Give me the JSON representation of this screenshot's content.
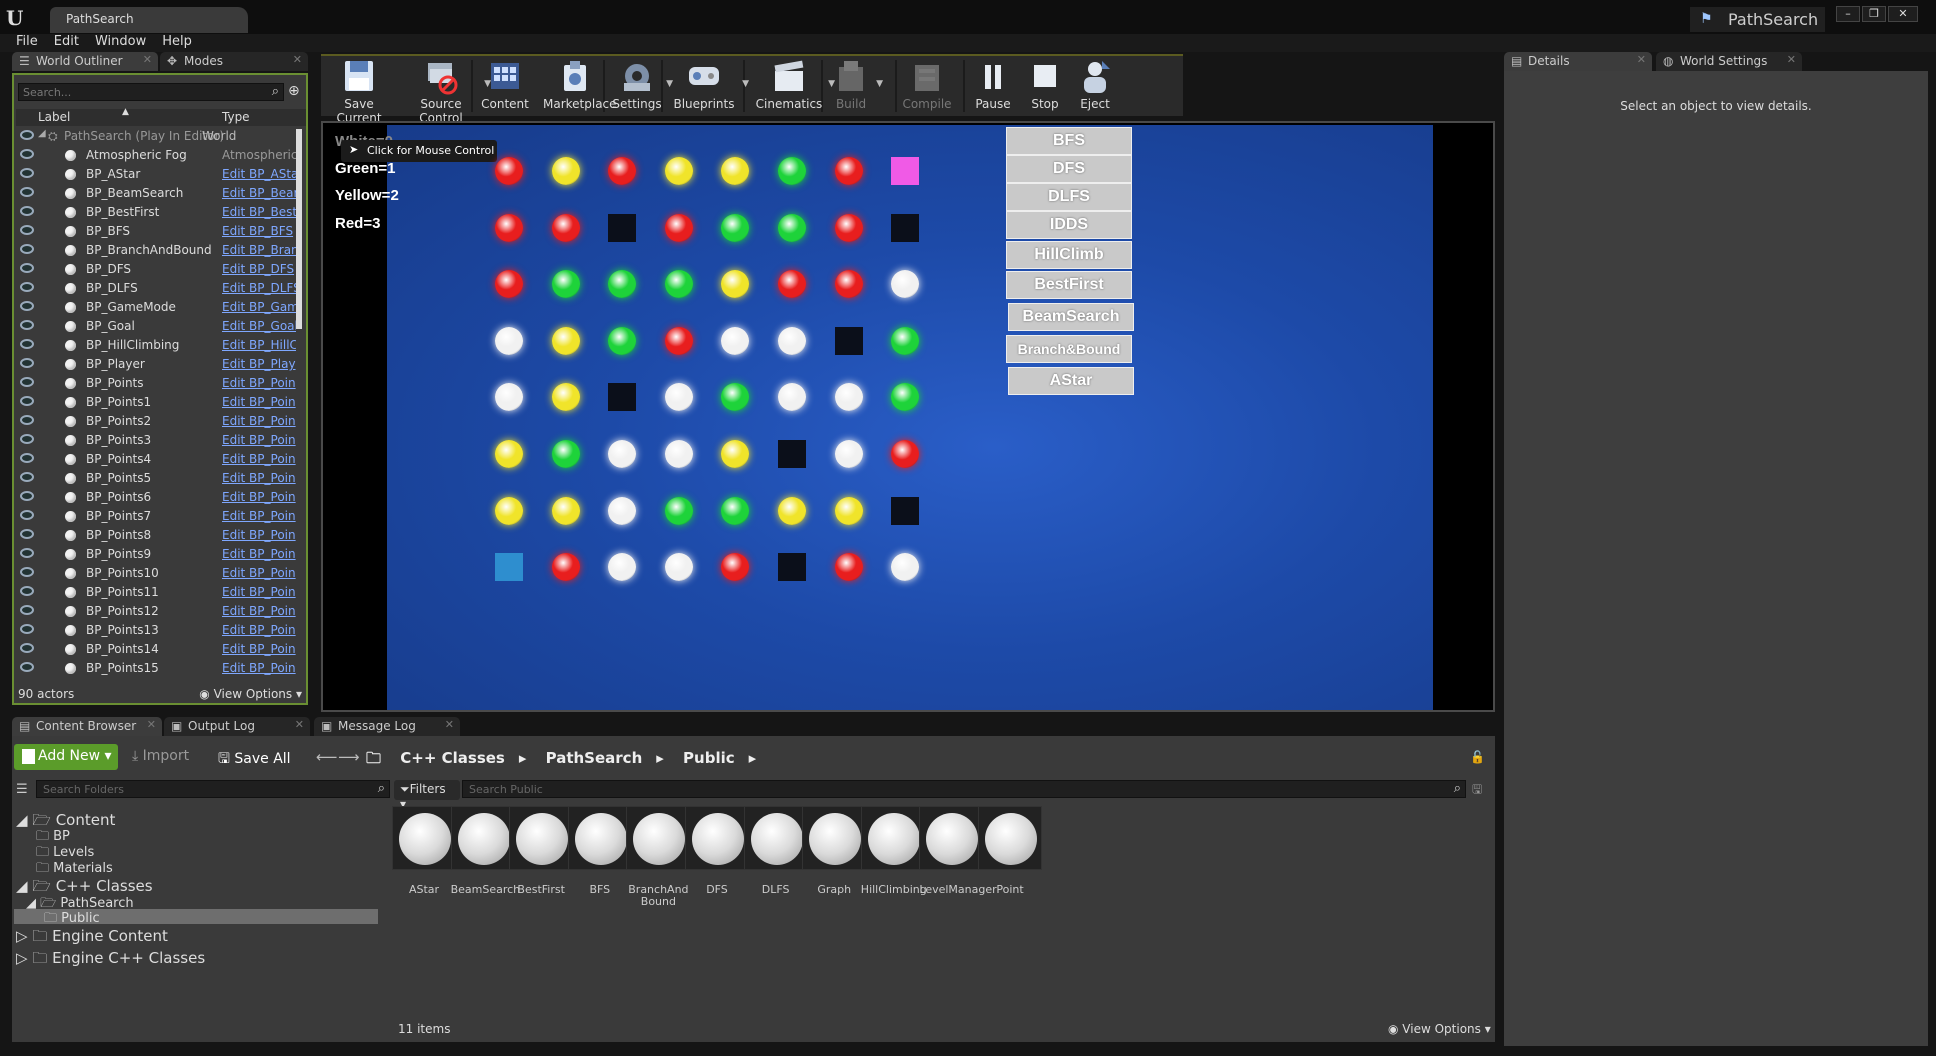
{
  "window": {
    "doc_tab": "PathSearch",
    "project_name": "PathSearch",
    "min": "–",
    "restore": "❐",
    "close": "✕"
  },
  "menu": [
    "File",
    "Edit",
    "Window",
    "Help"
  ],
  "outliner": {
    "tab_label": "World Outliner",
    "modes_tab_label": "Modes",
    "search_placeholder": "Search...",
    "col_label": "Label",
    "col_type": "Type",
    "root_label": "PathSearch (Play In Editor)",
    "root_type": "World",
    "rows": [
      {
        "label": "Atmospheric Fog",
        "type": "AtmosphericF"
      },
      {
        "label": "BP_AStar",
        "type": "Edit BP_AStar"
      },
      {
        "label": "BP_BeamSearch",
        "type": "Edit BP_Bear"
      },
      {
        "label": "BP_BestFirst",
        "type": "Edit BP_Best"
      },
      {
        "label": "BP_BFS",
        "type": "Edit BP_BFS"
      },
      {
        "label": "BP_BranchAndBound",
        "type": "Edit BP_Bran"
      },
      {
        "label": "BP_DFS",
        "type": "Edit BP_DFS"
      },
      {
        "label": "BP_DLFS",
        "type": "Edit BP_DLFS"
      },
      {
        "label": "BP_GameMode",
        "type": "Edit BP_Gam"
      },
      {
        "label": "BP_Goal",
        "type": "Edit BP_Goal"
      },
      {
        "label": "BP_HillClimbing",
        "type": "Edit BP_HillC"
      },
      {
        "label": "BP_Player",
        "type": "Edit BP_Play"
      },
      {
        "label": "BP_Points",
        "type": "Edit BP_Poin"
      },
      {
        "label": "BP_Points1",
        "type": "Edit BP_Poin"
      },
      {
        "label": "BP_Points2",
        "type": "Edit BP_Poin"
      },
      {
        "label": "BP_Points3",
        "type": "Edit BP_Poin"
      },
      {
        "label": "BP_Points4",
        "type": "Edit BP_Poin"
      },
      {
        "label": "BP_Points5",
        "type": "Edit BP_Poin"
      },
      {
        "label": "BP_Points6",
        "type": "Edit BP_Poin"
      },
      {
        "label": "BP_Points7",
        "type": "Edit BP_Poin"
      },
      {
        "label": "BP_Points8",
        "type": "Edit BP_Poin"
      },
      {
        "label": "BP_Points9",
        "type": "Edit BP_Poin"
      },
      {
        "label": "BP_Points10",
        "type": "Edit BP_Poin"
      },
      {
        "label": "BP_Points11",
        "type": "Edit BP_Poin"
      },
      {
        "label": "BP_Points12",
        "type": "Edit BP_Poin"
      },
      {
        "label": "BP_Points13",
        "type": "Edit BP_Poin"
      },
      {
        "label": "BP_Points14",
        "type": "Edit BP_Poin"
      },
      {
        "label": "BP_Points15",
        "type": "Edit BP_Poin"
      }
    ],
    "actor_count": "90 actors",
    "view_options": "View Options"
  },
  "toolbar": [
    {
      "label": "Save Current",
      "icon": "save-icon",
      "dropdown": false,
      "dim": false
    },
    {
      "label": "Source Control",
      "icon": "source-control-icon",
      "dropdown": true,
      "dim": false
    },
    {
      "label": "Content",
      "icon": "content-icon",
      "dropdown": false,
      "dim": false
    },
    {
      "label": "Marketplace",
      "icon": "marketplace-icon",
      "dropdown": false,
      "dim": false
    },
    {
      "label": "Settings",
      "icon": "settings-icon",
      "dropdown": true,
      "dim": false
    },
    {
      "label": "Blueprints",
      "icon": "blueprints-icon",
      "dropdown": true,
      "dim": false
    },
    {
      "label": "Cinematics",
      "icon": "cinematics-icon",
      "dropdown": true,
      "dim": false
    },
    {
      "label": "Build",
      "icon": "build-icon",
      "dropdown": true,
      "dim": true
    },
    {
      "label": "Compile",
      "icon": "compile-icon",
      "dropdown": false,
      "dim": true
    },
    {
      "label": "Pause",
      "icon": "pause-icon",
      "dropdown": false,
      "dim": false
    },
    {
      "label": "Stop",
      "icon": "stop-icon",
      "dropdown": false,
      "dim": false
    },
    {
      "label": "Eject",
      "icon": "eject-icon",
      "dropdown": false,
      "dim": false
    }
  ],
  "viewport": {
    "hud": [
      "White=0",
      "Green=1",
      "Yellow=2",
      "Red=3"
    ],
    "mouse_tip": "Click for Mouse Control",
    "colors": {
      "W": "#f1f1f1",
      "G": "#1ed33a",
      "Y": "#f0e42a",
      "R": "#e81e1e",
      "B": "#0b0f1a",
      "P": "#f05ae6",
      "C": "#2e8ecf"
    },
    "grid": [
      [
        "R",
        "Y",
        "R",
        "Y",
        "Y",
        "G",
        "R",
        "P"
      ],
      [
        "R",
        "R",
        "B",
        "R",
        "G",
        "G",
        "R",
        "B"
      ],
      [
        "R",
        "G",
        "G",
        "G",
        "Y",
        "R",
        "R",
        "W"
      ],
      [
        "W",
        "Y",
        "G",
        "R",
        "W",
        "W",
        "B",
        "G"
      ],
      [
        "W",
        "Y",
        "B",
        "W",
        "G",
        "W",
        "W",
        "G"
      ],
      [
        "Y",
        "G",
        "W",
        "W",
        "Y",
        "B",
        "W",
        "R"
      ],
      [
        "Y",
        "Y",
        "W",
        "G",
        "G",
        "Y",
        "Y",
        "B"
      ],
      [
        "C",
        "R",
        "W",
        "W",
        "R",
        "B",
        "R",
        "W"
      ]
    ],
    "algorithms": [
      "BFS",
      "DFS",
      "DLFS",
      "IDDS",
      "HillClimb",
      "BestFirst",
      "BeamSearch",
      "Branch&Bound",
      "AStar"
    ]
  },
  "details": {
    "tab_label": "Details",
    "world_settings_tab": "World Settings",
    "message": "Select an object to view details."
  },
  "bottom_tabs": [
    "Content Browser",
    "Output Log",
    "Message Log"
  ],
  "content_browser": {
    "add_new": "Add New",
    "import": "Import",
    "save_all": "Save All",
    "breadcrumb": [
      "C++ Classes",
      "PathSearch",
      "Public"
    ],
    "folder_search_placeholder": "Search Folders",
    "filters": "Filters",
    "path_search_placeholder": "Search Public",
    "tree": {
      "content": "Content",
      "bp": "BP",
      "levels": "Levels",
      "materials": "Materials",
      "cpp_classes": "C++ Classes",
      "pathsearch": "PathSearch",
      "public": "Public",
      "engine_content": "Engine Content",
      "engine_cpp": "Engine C++ Classes"
    },
    "assets": [
      "AStar",
      "BeamSearch",
      "BestFirst",
      "BFS",
      "BranchAnd Bound",
      "DFS",
      "DLFS",
      "Graph",
      "HillClimbing",
      "LevelManager",
      "Point"
    ],
    "item_count": "11 items",
    "view_options": "View Options"
  }
}
